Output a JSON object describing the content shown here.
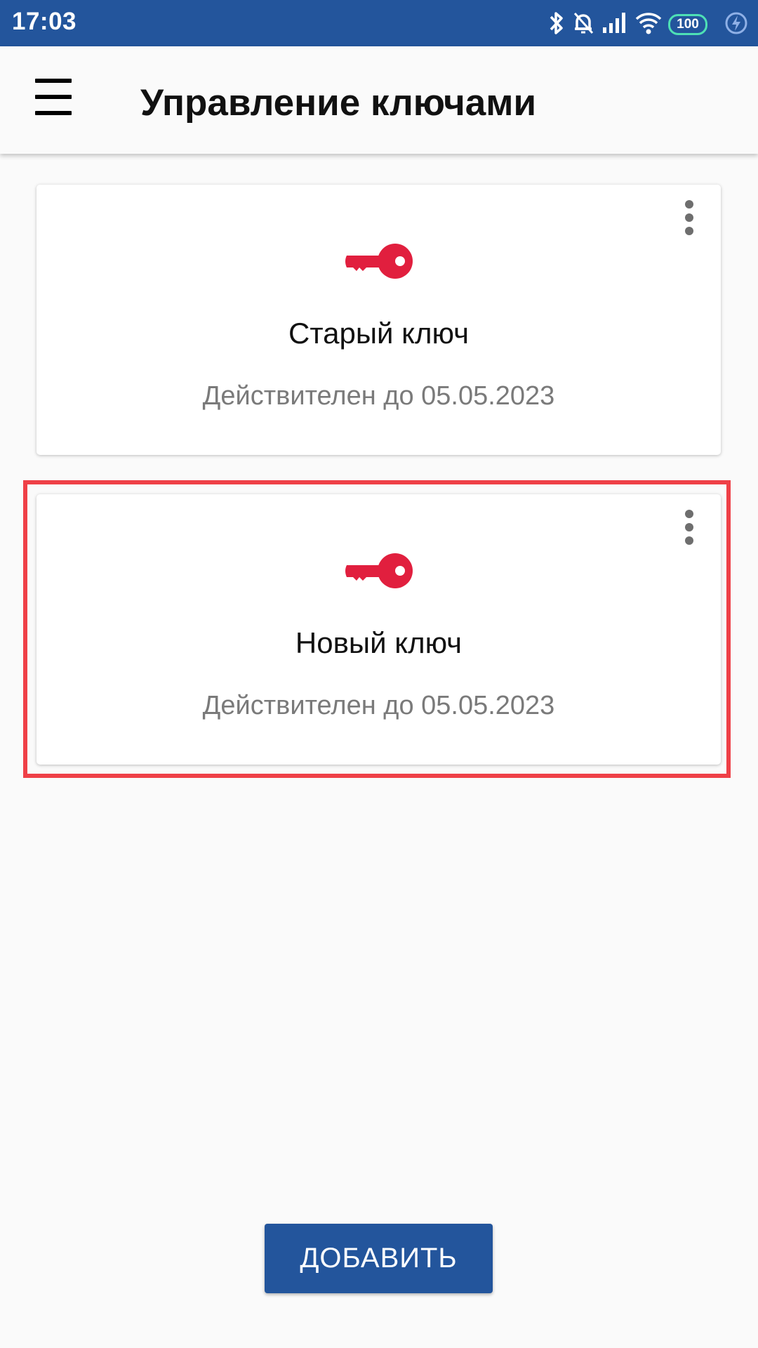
{
  "status_bar": {
    "time": "17:03",
    "battery": "100",
    "icons": [
      "bluetooth-icon",
      "alarm-off-icon",
      "signal-icon",
      "wifi-icon",
      "battery-icon",
      "charging-icon"
    ]
  },
  "app_bar": {
    "title": "Управление ключами",
    "menu_icon": "hamburger-menu-icon"
  },
  "keys": [
    {
      "name": "Старый ключ",
      "validity": "Действителен до 05.05.2023",
      "icon": "key-icon",
      "highlighted": false
    },
    {
      "name": "Новый ключ",
      "validity": "Действителен до 05.05.2023",
      "icon": "key-icon",
      "highlighted": true
    }
  ],
  "colors": {
    "primary": "#23559c",
    "key_icon": "#e11f3e",
    "highlight": "#ef4047",
    "secondary_text": "#7a7a7a"
  },
  "actions": {
    "add_label": "ДОБАВИТЬ"
  }
}
